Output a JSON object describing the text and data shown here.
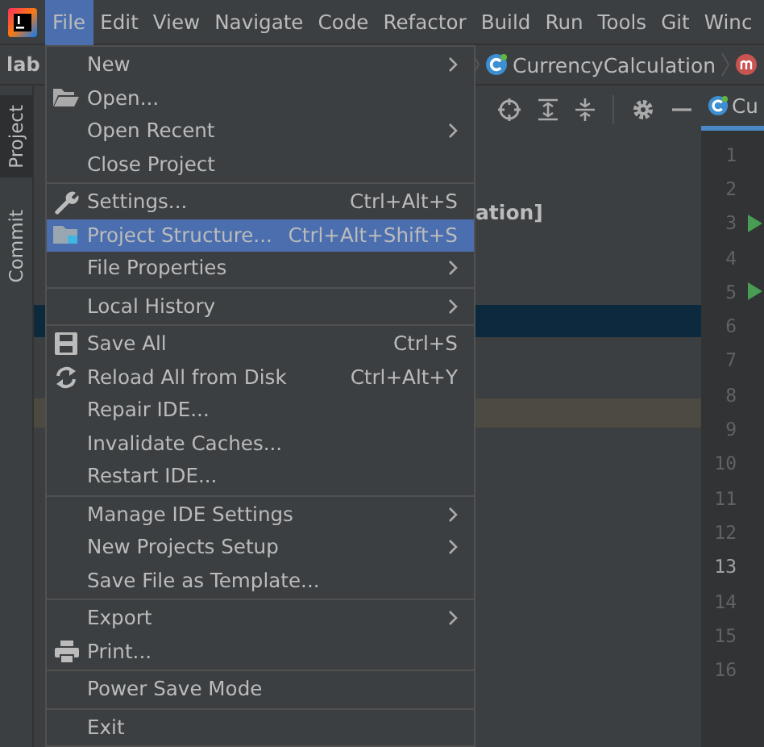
{
  "menubar": [
    {
      "label": "File",
      "selected": true
    },
    {
      "label": "Edit",
      "selected": false
    },
    {
      "label": "View",
      "selected": false
    },
    {
      "label": "Navigate",
      "selected": false
    },
    {
      "label": "Code",
      "selected": false
    },
    {
      "label": "Refactor",
      "selected": false
    },
    {
      "label": "Build",
      "selected": false
    },
    {
      "label": "Run",
      "selected": false
    },
    {
      "label": "Tools",
      "selected": false
    },
    {
      "label": "Git",
      "selected": false
    },
    {
      "label": "Winc",
      "selected": false
    }
  ],
  "navbar": {
    "project": "lab",
    "class_name": "CurrencyCalculation"
  },
  "tool_windows": [
    {
      "label": "Project",
      "selected": true
    },
    {
      "label": "Commit",
      "selected": false
    }
  ],
  "project_tree": {
    "visible_text": "ation]"
  },
  "editor_tab": {
    "label": "Cu"
  },
  "line_numbers": [
    {
      "number": "1",
      "current": false,
      "run_marker": false
    },
    {
      "number": "2",
      "current": false,
      "run_marker": false
    },
    {
      "number": "3",
      "current": false,
      "run_marker": true
    },
    {
      "number": "4",
      "current": false,
      "run_marker": false
    },
    {
      "number": "5",
      "current": false,
      "run_marker": true
    },
    {
      "number": "6",
      "current": false,
      "run_marker": false
    },
    {
      "number": "7",
      "current": false,
      "run_marker": false
    },
    {
      "number": "8",
      "current": false,
      "run_marker": false
    },
    {
      "number": "9",
      "current": false,
      "run_marker": false
    },
    {
      "number": "10",
      "current": false,
      "run_marker": false
    },
    {
      "number": "11",
      "current": false,
      "run_marker": false
    },
    {
      "number": "12",
      "current": false,
      "run_marker": false
    },
    {
      "number": "13",
      "current": true,
      "run_marker": false
    },
    {
      "number": "14",
      "current": false,
      "run_marker": false
    },
    {
      "number": "15",
      "current": false,
      "run_marker": false
    },
    {
      "number": "16",
      "current": false,
      "run_marker": false
    }
  ],
  "file_menu": [
    {
      "kind": "item",
      "label": "New",
      "submenu": true,
      "selected": false
    },
    {
      "kind": "item",
      "label": "Open...",
      "submenu": false,
      "selected": false
    },
    {
      "kind": "item",
      "label": "Open Recent",
      "submenu": true,
      "selected": false
    },
    {
      "kind": "item",
      "label": "Close Project",
      "submenu": false,
      "selected": false
    },
    {
      "kind": "separator"
    },
    {
      "kind": "item",
      "label": "Settings...",
      "shortcut": "Ctrl+Alt+S",
      "submenu": false,
      "selected": false
    },
    {
      "kind": "item",
      "label": "Project Structure...",
      "shortcut": "Ctrl+Alt+Shift+S",
      "submenu": false,
      "selected": true
    },
    {
      "kind": "item",
      "label": "File Properties",
      "submenu": true,
      "selected": false
    },
    {
      "kind": "separator"
    },
    {
      "kind": "item",
      "label": "Local History",
      "submenu": true,
      "selected": false
    },
    {
      "kind": "separator"
    },
    {
      "kind": "item",
      "label": "Save All",
      "shortcut": "Ctrl+S",
      "submenu": false,
      "selected": false
    },
    {
      "kind": "item",
      "label": "Reload All from Disk",
      "shortcut": "Ctrl+Alt+Y",
      "submenu": false,
      "selected": false
    },
    {
      "kind": "item",
      "label": "Repair IDE...",
      "submenu": false,
      "selected": false
    },
    {
      "kind": "item",
      "label": "Invalidate Caches...",
      "submenu": false,
      "selected": false
    },
    {
      "kind": "item",
      "label": "Restart IDE...",
      "submenu": false,
      "selected": false
    },
    {
      "kind": "separator"
    },
    {
      "kind": "item",
      "label": "Manage IDE Settings",
      "submenu": true,
      "selected": false
    },
    {
      "kind": "item",
      "label": "New Projects Setup",
      "submenu": true,
      "selected": false
    },
    {
      "kind": "item",
      "label": "Save File as Template...",
      "submenu": false,
      "selected": false
    },
    {
      "kind": "separator"
    },
    {
      "kind": "item",
      "label": "Export",
      "submenu": true,
      "selected": false
    },
    {
      "kind": "item",
      "label": "Print...",
      "submenu": false,
      "selected": false
    },
    {
      "kind": "separator"
    },
    {
      "kind": "item",
      "label": "Power Save Mode",
      "submenu": false,
      "selected": false
    },
    {
      "kind": "separator"
    },
    {
      "kind": "item",
      "label": "Exit",
      "submenu": false,
      "selected": false
    }
  ]
}
